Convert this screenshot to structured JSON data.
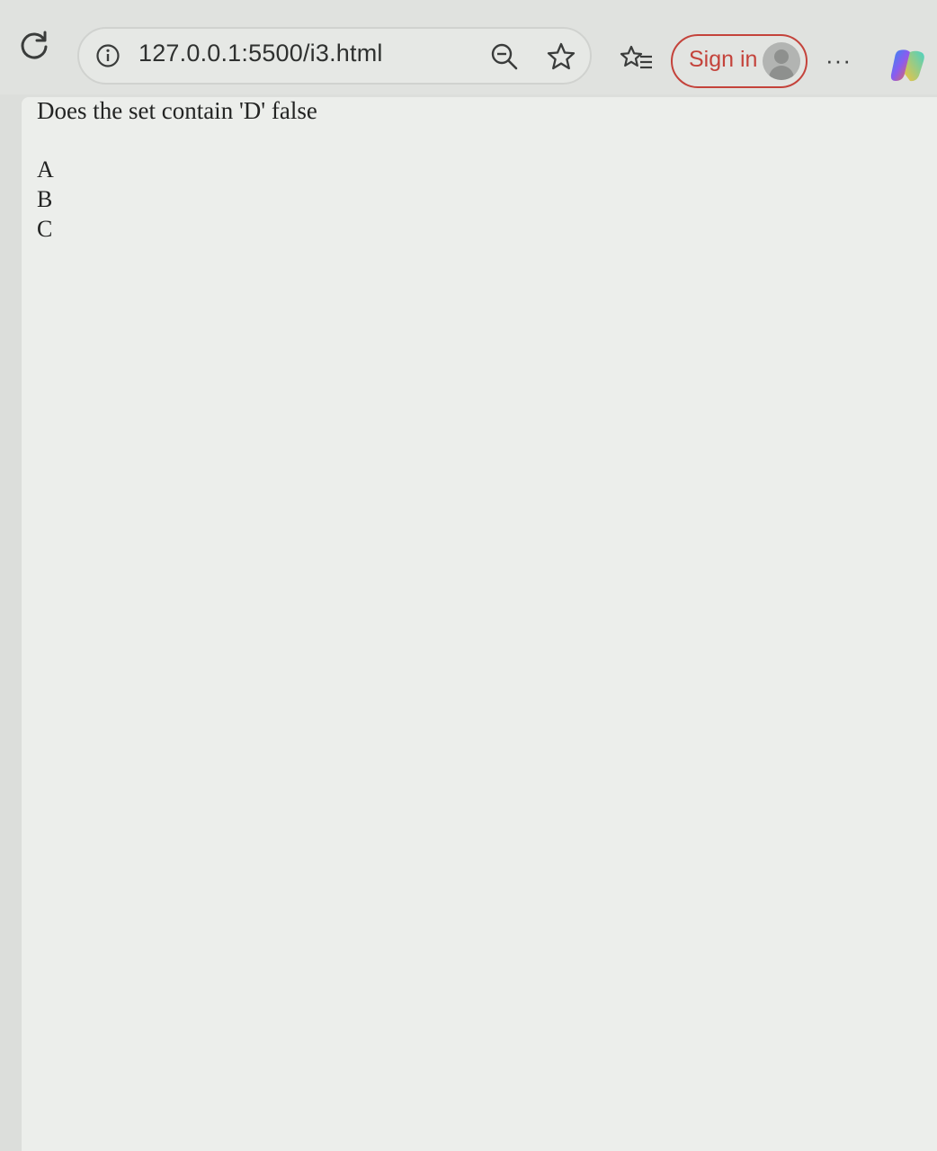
{
  "browser": {
    "url": "127.0.0.1:5500/i3.html",
    "signin_label": "Sign in",
    "more_label": "···",
    "accent_color": "#c4433b",
    "icons": [
      "reload-icon",
      "info-icon",
      "zoom-out-icon",
      "star-icon",
      "favorites-icon",
      "avatar",
      "more-icon",
      "copilot-icon"
    ]
  },
  "page": {
    "heading": "Does the set contain 'D' false",
    "items": [
      {
        "label": "A"
      },
      {
        "label": "B"
      },
      {
        "label": "C"
      }
    ]
  }
}
